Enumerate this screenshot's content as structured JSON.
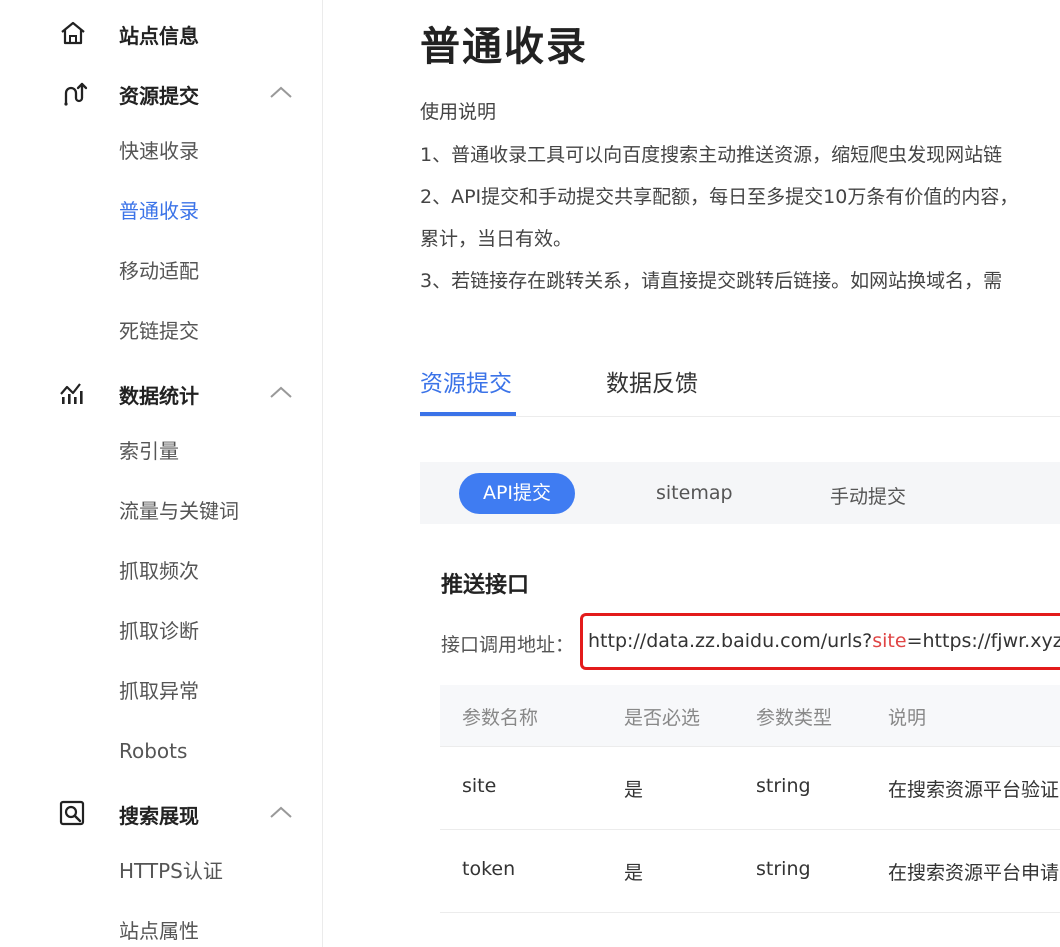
{
  "sidebar": {
    "groups": [
      {
        "label": "站点信息",
        "icon": "home-icon",
        "items": []
      },
      {
        "label": "资源提交",
        "icon": "submit-icon",
        "collapse_icon": "chevron-up-icon",
        "items": [
          "快速收录",
          "普通收录",
          "移动适配",
          "死链提交"
        ]
      },
      {
        "label": "数据统计",
        "icon": "stats-icon",
        "collapse_icon": "chevron-up-icon",
        "items": [
          "索引量",
          "流量与关键词",
          "抓取频次",
          "抓取诊断",
          "抓取异常",
          "Robots"
        ]
      },
      {
        "label": "搜索展现",
        "icon": "search-display-icon",
        "collapse_icon": "chevron-up-icon",
        "items": [
          "HTTPS认证",
          "站点属性"
        ]
      }
    ],
    "active_item": "普通收录"
  },
  "main": {
    "title": "普通收录",
    "usage_title": "使用说明",
    "usage_lines": [
      "1、普通收录工具可以向百度搜索主动推送资源，缩短爬虫发现网站链",
      "2、API提交和手动提交共享配额，每日至多提交10万条有价值的内容，",
      "累计，当日有效。",
      "3、若链接存在跳转关系，请直接提交跳转后链接。如网站换域名，需"
    ],
    "tabs": [
      {
        "label": "资源提交",
        "active": true
      },
      {
        "label": "数据反馈",
        "active": false
      }
    ],
    "subtabs": [
      {
        "label": "API提交",
        "active": true
      },
      {
        "label": "sitemap",
        "active": false
      },
      {
        "label": "手动提交",
        "active": false
      }
    ],
    "section_title": "推送接口",
    "endpoint": {
      "label": "接口调用地址：",
      "url_prefix": "http://data.zz.baidu.com/urls?",
      "url_param_key": "site",
      "url_suffix": "=https://fjwr.xyz"
    },
    "table": {
      "headers": [
        "参数名称",
        "是否必选",
        "参数类型",
        "说明"
      ],
      "rows": [
        [
          "site",
          "是",
          "string",
          "在搜索资源平台验证"
        ],
        [
          "token",
          "是",
          "string",
          "在搜索资源平台申请"
        ]
      ]
    }
  },
  "colors": {
    "accent": "#3b73e8",
    "pill": "#3f7cf2",
    "highlight_border": "#e31b1b",
    "url_param": "#e04545"
  }
}
